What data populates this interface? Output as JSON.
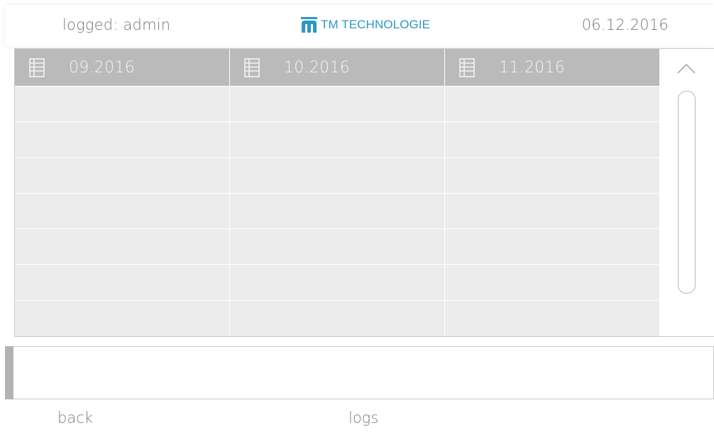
{
  "header": {
    "user_label": "logged: admin",
    "brand_text": "TM TECHNOLOGIE",
    "date": "06.12.2016",
    "brand_color": "#2e97c5"
  },
  "grid": {
    "columns": [
      {
        "label": "09.2016",
        "icon": "table-icon"
      },
      {
        "label": "10.2016",
        "icon": "table-icon"
      },
      {
        "label": "11.2016",
        "icon": "table-icon"
      }
    ],
    "row_count": 7
  },
  "scrollbar": {
    "up_icon": "chevron-up-icon"
  },
  "footer": {
    "back_label": "back",
    "title": "logs"
  },
  "colors": {
    "header_cell": "#bababa",
    "body_cell": "#ececec",
    "text_muted": "#777777",
    "accent_bar": "#b3b3b3"
  }
}
